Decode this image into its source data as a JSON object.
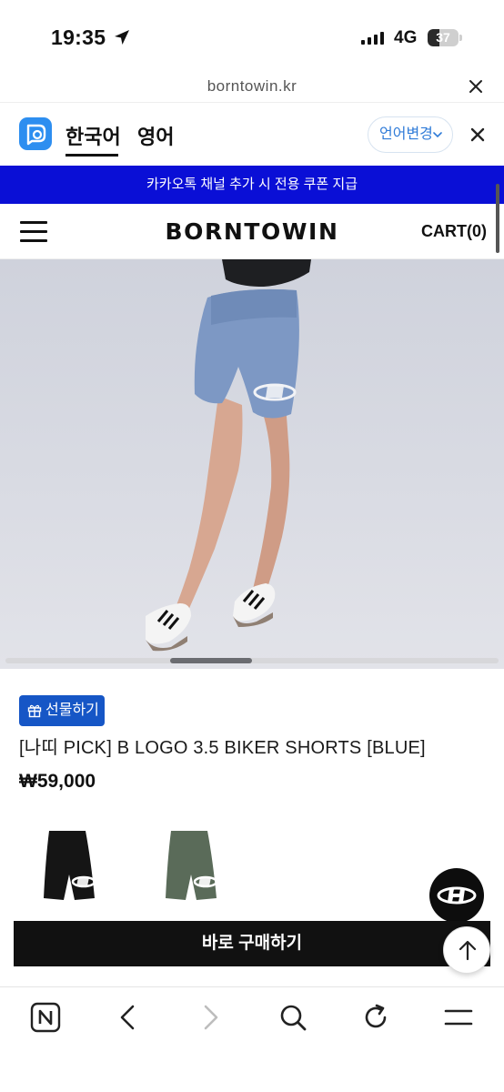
{
  "status_bar": {
    "time": "19:35",
    "network": "4G",
    "battery": "37",
    "battery_level": 0.37
  },
  "url_bar": {
    "url": "borntowin.kr"
  },
  "translate_bar": {
    "tabs": [
      "한국어",
      "영어"
    ],
    "change_language": "언어변경"
  },
  "promo_banner": {
    "text": "카카오톡 채널 추가 시 전용 쿠폰 지급"
  },
  "header": {
    "brand": "BORNTOWIN",
    "cart": "CART(0)"
  },
  "product": {
    "gift_label": "선물하기",
    "title": "[나띠 PICK] B LOGO 3.5 BIKER SHORTS [BLUE]",
    "price": "₩59,000",
    "colors": {
      "current": "#7d98c4",
      "variants": [
        "#151515",
        "#5a6b59"
      ]
    }
  },
  "buy_button": {
    "label": "바로 구매하기"
  },
  "colors": {
    "banner": "#0a0fd6",
    "gift_button": "#1656c6",
    "accent_blue": "#2f7bd8"
  }
}
